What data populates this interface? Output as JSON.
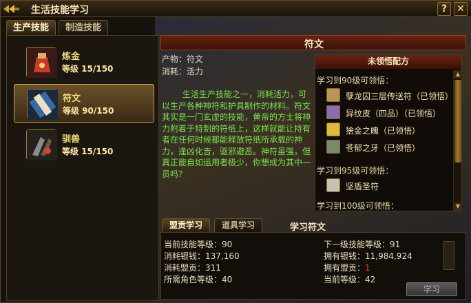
{
  "window": {
    "title": "生活技能学习"
  },
  "titlebar": {
    "help_label": "?",
    "close_label": "✕"
  },
  "tabs": [
    {
      "label": "生产技能",
      "active": true
    },
    {
      "label": "制造技能",
      "active": false
    }
  ],
  "skills": [
    {
      "name": "炼金",
      "level": "等级 15/150",
      "icon": "alchemy-bag-icon",
      "selected": false
    },
    {
      "name": "符文",
      "level": "等级 90/150",
      "icon": "rune-scroll-icon",
      "selected": true
    },
    {
      "name": "驯兽",
      "level": "等级 15/150",
      "icon": "beast-claw-icon",
      "selected": false
    }
  ],
  "detail": {
    "header": "符文",
    "product_label": "产物：符文",
    "consume_label": "消耗：活力",
    "description": "生活生产技能之一，消耗活力，可以生产各种神符和护具制作的材料。符文其实是一门玄虚的技能，黄帝的方士将神力附着于特制的符纸上，这样就能让持有者在任何时候都能释放符纸所承载的神力，逢凶化吉，驱邪避恶。神符虽强，但真正能自如运用者极少，你想成为其中一员吗？"
  },
  "recipes": {
    "header": "未领悟配方",
    "sections": [
      {
        "label": "学习到90级可领悟：",
        "items": [
          {
            "name": "孽龙囚三层传送符（已领悟）",
            "icon": "rune-icon"
          },
          {
            "name": "异纹皮（四品）（已领悟）",
            "icon": "hide-icon"
          },
          {
            "name": "猞金之魄（已领悟）",
            "icon": "gold-ingot-icon"
          },
          {
            "name": "苍郁之牙（已领悟）",
            "icon": "fang-icon"
          }
        ]
      },
      {
        "label": "学习到95级可领悟：",
        "items": [
          {
            "name": "坚盾圣符",
            "icon": "shield-rune-icon"
          }
        ]
      },
      {
        "label": "学习到100级可领悟：",
        "items": []
      }
    ]
  },
  "lower_tabs": [
    {
      "label": "盟贡学习",
      "active": true
    },
    {
      "label": "道具学习",
      "active": false
    }
  ],
  "learn_title": "学习符文",
  "stats": {
    "current_level": "当前技能等级：90",
    "cost_silver": "消耗银钱：137,160",
    "cost_contrib": "消耗盟贡：311",
    "req_level": "所需角色等级：40",
    "next_level": "下一级技能等级：91",
    "own_silver": "拥有银钱：11,984,924",
    "own_contrib_label": "拥有盟贡：",
    "own_contrib_value": "1",
    "cur_level": "当前等级：42"
  },
  "learn_button": "学习",
  "colors": {
    "description": "#7ce050",
    "highlight": "#f4dc7a",
    "warning": "#ff3b2a"
  }
}
